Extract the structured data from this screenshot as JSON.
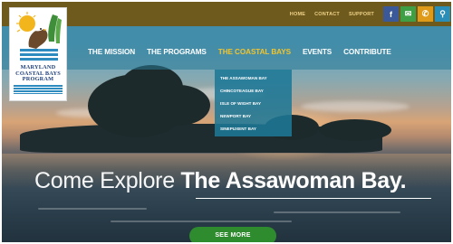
{
  "topbar": {
    "links": [
      "HOME",
      "CONTACT",
      "SUPPORT"
    ],
    "social": [
      {
        "icon": "facebook-icon",
        "glyph": "f",
        "color": "#3b5998"
      },
      {
        "icon": "mail-icon",
        "glyph": "✉",
        "color": "#3f9f45"
      },
      {
        "icon": "phone-icon",
        "glyph": "✆",
        "color": "#e09a1a"
      },
      {
        "icon": "map-pin-icon",
        "glyph": "⚲",
        "color": "#2a8fb8"
      }
    ]
  },
  "logo": {
    "line1": "MARYLAND",
    "line2": "COASTAL BAYS",
    "line3": "PROGRAM"
  },
  "nav": {
    "items": [
      "THE MISSION",
      "THE PROGRAMS",
      "THE COASTAL BAYS",
      "EVENTS",
      "CONTRIBUTE"
    ],
    "active_index": 2,
    "active_color": "#f0c430"
  },
  "dropdown": {
    "items": [
      "THE ASSAWOMAN BAY",
      "CHINCOTEAGUE BAY",
      "ISLE OF WIGHT BAY",
      "NEWPORT BAY",
      "SINEPUXENT BAY"
    ]
  },
  "hero": {
    "headline_light": "Come Explore ",
    "headline_bold": "The Assawoman Bay",
    "headline_end": ".",
    "cta_label": "SEE MORE"
  },
  "colors": {
    "topbar": "#6d5a1c",
    "cta": "#2e8b2e",
    "nav_overlay": "#2878a0"
  }
}
